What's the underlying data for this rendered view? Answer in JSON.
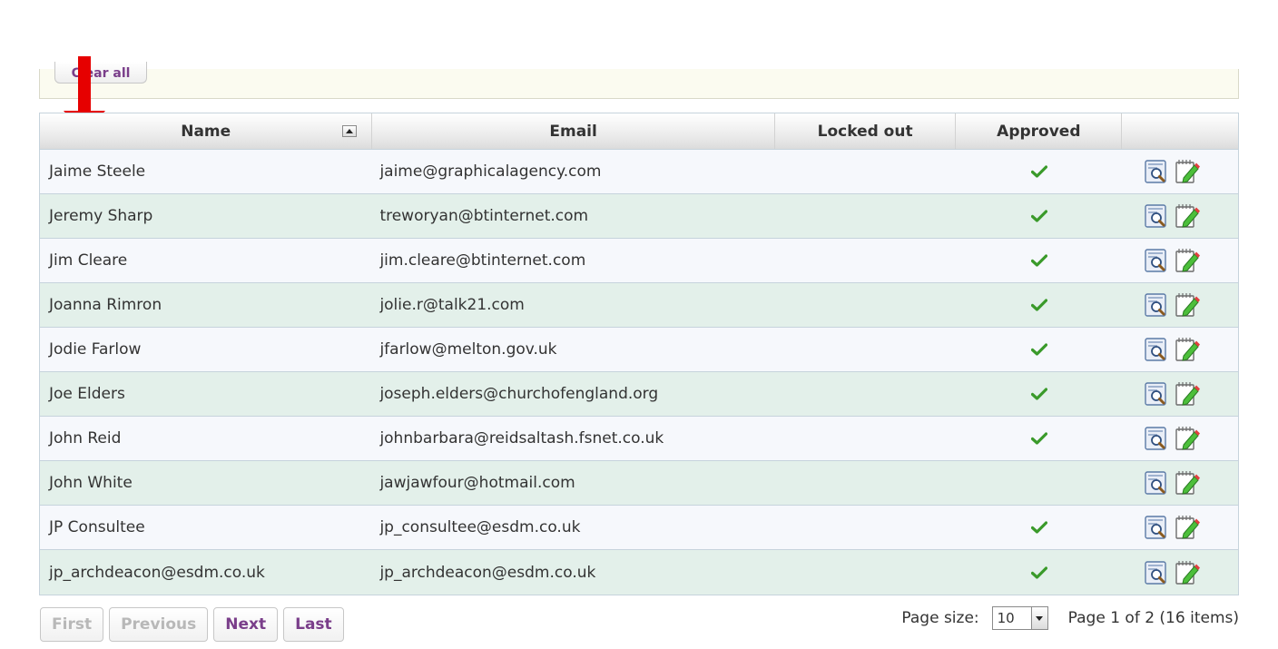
{
  "filter": {
    "clear_all_label": "Clear all"
  },
  "grid": {
    "columns": {
      "name": "Name",
      "email": "Email",
      "locked_out": "Locked out",
      "approved": "Approved",
      "actions": ""
    },
    "rows": [
      {
        "name": "Jaime Steele",
        "email": "jaime@graphicalagency.com",
        "locked_out": false,
        "approved": true
      },
      {
        "name": "Jeremy Sharp",
        "email": "treworyan@btinternet.com",
        "locked_out": false,
        "approved": true
      },
      {
        "name": "Jim Cleare",
        "email": "jim.cleare@btinternet.com",
        "locked_out": false,
        "approved": true
      },
      {
        "name": "Joanna Rimron",
        "email": "jolie.r@talk21.com",
        "locked_out": false,
        "approved": true
      },
      {
        "name": "Jodie Farlow",
        "email": "jfarlow@melton.gov.uk",
        "locked_out": false,
        "approved": true
      },
      {
        "name": "Joe Elders",
        "email": "joseph.elders@churchofengland.org",
        "locked_out": false,
        "approved": true
      },
      {
        "name": "John Reid",
        "email": "johnbarbara@reidsaltash.fsnet.co.uk",
        "locked_out": false,
        "approved": true
      },
      {
        "name": "John White",
        "email": "jawjawfour@hotmail.com",
        "locked_out": false,
        "approved": false
      },
      {
        "name": "JP Consultee",
        "email": "jp_consultee@esdm.co.uk",
        "locked_out": false,
        "approved": true
      },
      {
        "name": "jp_archdeacon@esdm.co.uk",
        "email": "jp_archdeacon@esdm.co.uk",
        "locked_out": false,
        "approved": true
      }
    ]
  },
  "pager": {
    "first_label": "First",
    "previous_label": "Previous",
    "next_label": "Next",
    "last_label": "Last",
    "page_size_label": "Page size:",
    "page_size_value": "10",
    "page_info": "Page 1 of 2 (16 items)"
  },
  "icons": {
    "approved": "check-icon",
    "view": "view-details-icon",
    "edit": "edit-icon",
    "annotation": "red-arrow-icon"
  },
  "colors": {
    "accent": "#7a3e8a",
    "row_odd": "#f6f8fc",
    "row_even": "#e3f0ea",
    "check_green": "#3a9a2a",
    "annotation_red": "#e60000"
  }
}
